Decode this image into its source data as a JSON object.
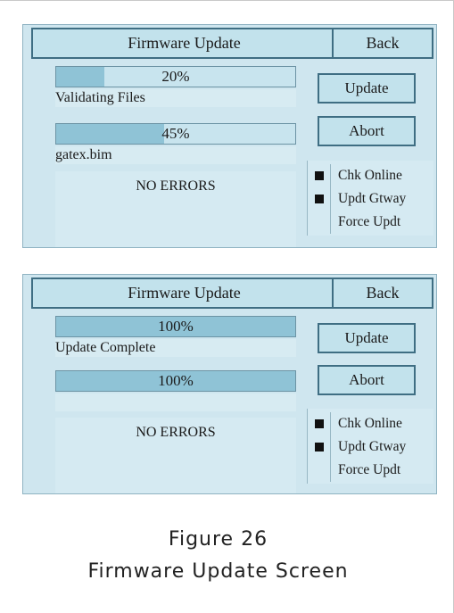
{
  "colors": {
    "panel_bg": "#cfe6ef",
    "button_bg": "#c2e2ec",
    "button_border": "#3f6e83",
    "progress_fill": "#8fc3d6",
    "check_mark": "#111111"
  },
  "screens": [
    {
      "title": "Firmware Update",
      "back_label": "Back",
      "progress": [
        {
          "percent_label": "20%",
          "fraction": 0.2,
          "status": "Validating Files"
        },
        {
          "percent_label": "45%",
          "fraction": 0.45,
          "status": "gatex.bim"
        }
      ],
      "errors": "NO ERRORS",
      "update_label": "Update",
      "abort_label": "Abort",
      "checks": [
        {
          "label": "Chk Online",
          "checked": true
        },
        {
          "label": "Updt Gtway",
          "checked": true
        },
        {
          "label": "Force Updt",
          "checked": false
        }
      ]
    },
    {
      "title": "Firmware Update",
      "back_label": "Back",
      "progress": [
        {
          "percent_label": "100%",
          "fraction": 1.0,
          "status": "Update Complete"
        },
        {
          "percent_label": "100%",
          "fraction": 1.0,
          "status": ""
        }
      ],
      "errors": "NO ERRORS",
      "update_label": "Update",
      "abort_label": "Abort",
      "checks": [
        {
          "label": "Chk Online",
          "checked": true
        },
        {
          "label": "Updt Gtway",
          "checked": true
        },
        {
          "label": "Force Updt",
          "checked": false
        }
      ]
    }
  ],
  "caption": {
    "figure": "Figure 26",
    "title": "Firmware Update Screen"
  }
}
